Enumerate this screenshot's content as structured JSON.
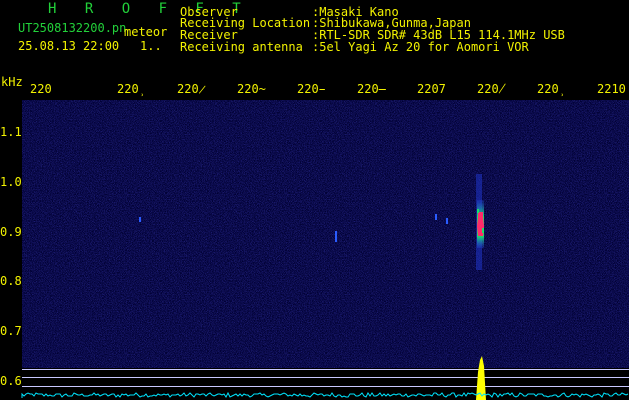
{
  "header": {
    "app_title": "H R O F F T",
    "filename": "UT2508132200.pn",
    "tag": "meteor",
    "datetime": "25.08.13 22:00",
    "counter": "1..",
    "fields": [
      {
        "label": "Observer",
        "value": ":Masaki Kano"
      },
      {
        "label": "Receiving Location",
        "value": ":Shibukawa,Gunma,Japan"
      },
      {
        "label": "Receiver",
        "value": ":RTL-SDR SDR# 43dB L15 114.1MHz USB"
      },
      {
        "label": "Receiving antenna",
        "value": ":5el Yagi Az 20 for Aomori VOR"
      }
    ]
  },
  "axes": {
    "y_unit": "kHz",
    "y_ticks": [
      "1.1",
      "1.0",
      "0.9",
      "0.8",
      "0.7",
      "0.6"
    ],
    "x_ticks": [
      "220",
      "220̹",
      "220̷",
      "220̴",
      "220̵",
      "220̶",
      "2207",
      "220̸",
      "220̹",
      "2210"
    ]
  },
  "colors": {
    "background": "#000000",
    "noise_floor": "#0a0a55",
    "header_green": "#22d13a",
    "label_yellow": "#f2f200",
    "grid_line": "#c8c8ff",
    "echo_core": "#ff2a6a",
    "echo_mid": "#19e06a",
    "echo_outer": "#2a5cff",
    "spectrum_trace": "#00e5ff",
    "spectrum_peak": "#ffff00"
  }
}
